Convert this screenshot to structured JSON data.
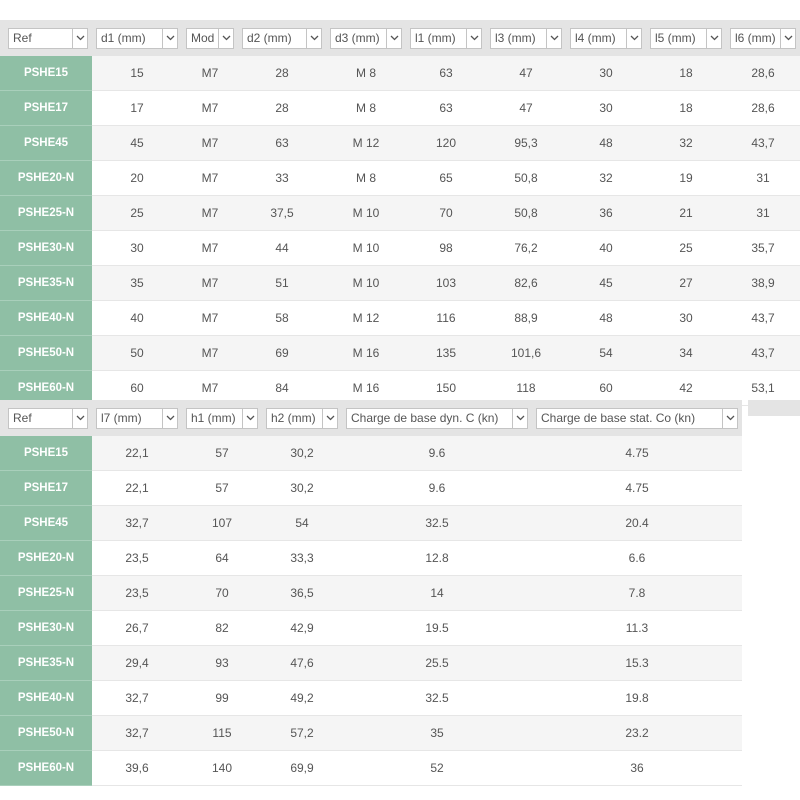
{
  "table1": {
    "headers": [
      "Ref",
      "d1 (mm)",
      "Mod",
      "d2 (mm)",
      "d3 (mm)",
      "l1 (mm)",
      "l3 (mm)",
      "l4 (mm)",
      "l5 (mm)",
      "l6 (mm)"
    ],
    "rows": [
      [
        "PSHE15",
        "15",
        "M7",
        "28",
        "M 8",
        "63",
        "47",
        "30",
        "18",
        "28,6"
      ],
      [
        "PSHE17",
        "17",
        "M7",
        "28",
        "M 8",
        "63",
        "47",
        "30",
        "18",
        "28,6"
      ],
      [
        "PSHE45",
        "45",
        "M7",
        "63",
        "M 12",
        "120",
        "95,3",
        "48",
        "32",
        "43,7"
      ],
      [
        "PSHE20-N",
        "20",
        "M7",
        "33",
        "M 8",
        "65",
        "50,8",
        "32",
        "19",
        "31"
      ],
      [
        "PSHE25-N",
        "25",
        "M7",
        "37,5",
        "M 10",
        "70",
        "50,8",
        "36",
        "21",
        "31"
      ],
      [
        "PSHE30-N",
        "30",
        "M7",
        "44",
        "M 10",
        "98",
        "76,2",
        "40",
        "25",
        "35,7"
      ],
      [
        "PSHE35-N",
        "35",
        "M7",
        "51",
        "M 10",
        "103",
        "82,6",
        "45",
        "27",
        "38,9"
      ],
      [
        "PSHE40-N",
        "40",
        "M7",
        "58",
        "M 12",
        "116",
        "88,9",
        "48",
        "30",
        "43,7"
      ],
      [
        "PSHE50-N",
        "50",
        "M7",
        "69",
        "M 16",
        "135",
        "101,6",
        "54",
        "34",
        "43,7"
      ],
      [
        "PSHE60-N",
        "60",
        "M7",
        "84",
        "M 16",
        "150",
        "118",
        "60",
        "42",
        "53,1"
      ]
    ]
  },
  "table2": {
    "headers": [
      "Ref",
      "l7 (mm)",
      "h1 (mm)",
      "h2 (mm)",
      "Charge de base dyn. C (kn)",
      "Charge de base stat. Co (kn)"
    ],
    "rows": [
      [
        "PSHE15",
        "22,1",
        "57",
        "30,2",
        "9.6",
        "4.75"
      ],
      [
        "PSHE17",
        "22,1",
        "57",
        "30,2",
        "9.6",
        "4.75"
      ],
      [
        "PSHE45",
        "32,7",
        "107",
        "54",
        "32.5",
        "20.4"
      ],
      [
        "PSHE20-N",
        "23,5",
        "64",
        "33,3",
        "12.8",
        "6.6"
      ],
      [
        "PSHE25-N",
        "23,5",
        "70",
        "36,5",
        "14",
        "7.8"
      ],
      [
        "PSHE30-N",
        "26,7",
        "82",
        "42,9",
        "19.5",
        "11.3"
      ],
      [
        "PSHE35-N",
        "29,4",
        "93",
        "47,6",
        "25.5",
        "15.3"
      ],
      [
        "PSHE40-N",
        "32,7",
        "99",
        "49,2",
        "32.5",
        "19.8"
      ],
      [
        "PSHE50-N",
        "32,7",
        "115",
        "57,2",
        "35",
        "23.2"
      ],
      [
        "PSHE60-N",
        "39,6",
        "140",
        "69,9",
        "52",
        "36"
      ]
    ]
  },
  "icons": {
    "dropdown": "chevron-down-icon"
  },
  "colors": {
    "ref_column": "#8fbfa5",
    "header_bg": "#e4e4e4",
    "row_alt": "#f5f5f5",
    "text": "#555555"
  }
}
